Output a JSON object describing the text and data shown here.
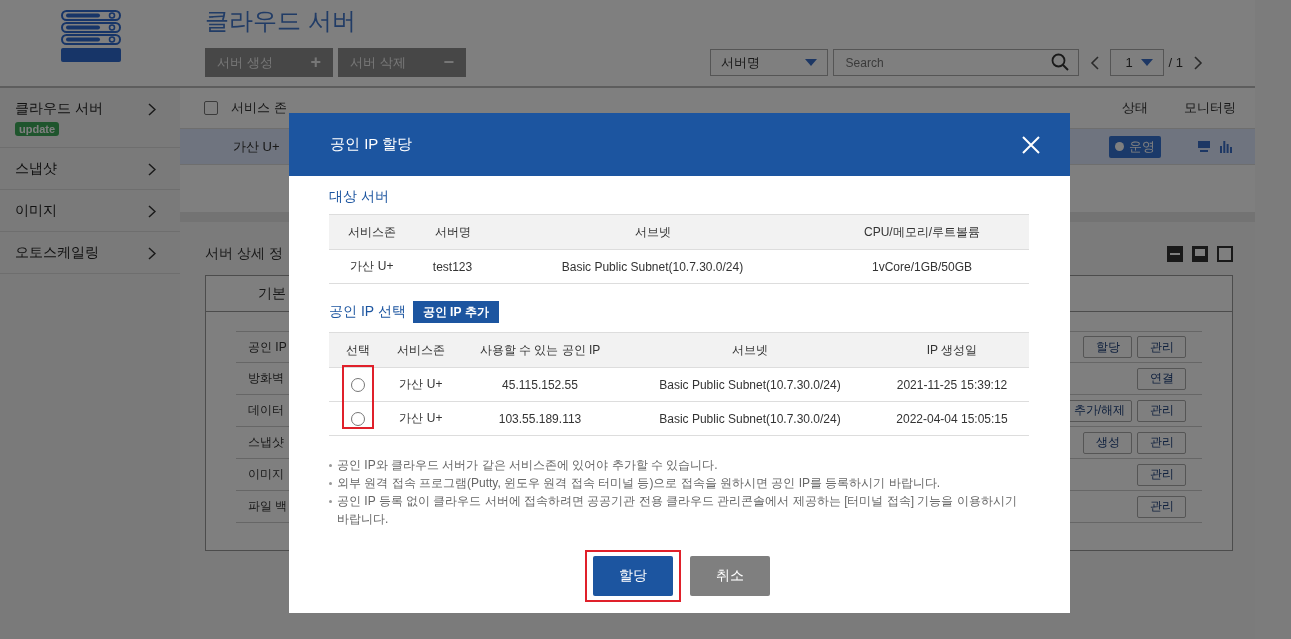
{
  "sidebar": {
    "items": [
      {
        "label": "클라우드 서버",
        "badge": "update"
      },
      {
        "label": "스냅샷"
      },
      {
        "label": "이미지"
      },
      {
        "label": "오토스케일링"
      }
    ]
  },
  "page": {
    "title": "클라우드 서버",
    "actions": [
      {
        "label": "서버 생성",
        "icon": "+"
      },
      {
        "label": "서버 삭제",
        "icon": "−"
      }
    ],
    "filter": {
      "field": "서버명",
      "search_placeholder": "Search"
    },
    "pagination": {
      "page": "1",
      "total": "/ 1"
    }
  },
  "server_table": {
    "select_all_checked": false,
    "columns": [
      "서비스 존",
      "상태",
      "모니터링"
    ],
    "rows": [
      {
        "zone": "가산 U+",
        "status": "운영",
        "selected": true
      }
    ]
  },
  "details": {
    "title": "서버 상세 정",
    "tab": "기본",
    "rows": [
      {
        "label": "공인 IP",
        "actions": [
          "할당",
          "관리"
        ]
      },
      {
        "label": "방화벽",
        "actions": [
          "연결"
        ]
      },
      {
        "label": "데이터",
        "actions": [
          "추가/해제",
          "관리"
        ]
      },
      {
        "label": "스냅샷",
        "actions": [
          "생성",
          "관리"
        ]
      },
      {
        "label": "이미지",
        "actions": [
          "관리"
        ]
      },
      {
        "label": "파일 백",
        "actions": [
          "관리"
        ]
      }
    ]
  },
  "dialog": {
    "title": "공인 IP 할당",
    "target": {
      "title": "대상 서버",
      "columns": [
        "서비스존",
        "서버명",
        "서브넷",
        "CPU/메모리/루트볼륨"
      ],
      "rows": [
        [
          "가산 U+",
          "test123",
          "Basic Public Subnet(10.7.30.0/24)",
          "1vCore/1GB/50GB"
        ]
      ]
    },
    "ip_select": {
      "title": "공인 IP 선택",
      "add_button": "공인 IP 추가",
      "select_column": "선택",
      "columns": [
        "서비스존",
        "사용할 수 있는 공인 IP",
        "서브넷",
        "IP 생성일"
      ],
      "rows": [
        {
          "selected": false,
          "cells": [
            "가산 U+",
            "45.115.152.55",
            "Basic Public Subnet(10.7.30.0/24)",
            "2021-11-25 15:39:12"
          ]
        },
        {
          "selected": false,
          "cells": [
            "가산 U+",
            "103.55.189.113",
            "Basic Public Subnet(10.7.30.0/24)",
            "2022-04-04 15:05:15"
          ]
        }
      ]
    },
    "notes": [
      "공인 IP와 클라우드 서버가 같은 서비스존에 있어야 추가할 수 있습니다.",
      "외부 원격 접속 프로그램(Putty, 윈도우 원격 접속 터미널 등)으로 접속을 원하시면 공인 IP를 등록하시기 바랍니다.",
      "공인 IP 등록 없이 클라우드 서버에 접속하려면 공공기관 전용 클라우드 관리콘솔에서 제공하는 [터미널 접속] 기능을 이용하시기 바랍니다."
    ],
    "buttons": [
      {
        "label": "할당",
        "kind": "primary"
      },
      {
        "label": "취소",
        "kind": "secondary"
      }
    ]
  }
}
